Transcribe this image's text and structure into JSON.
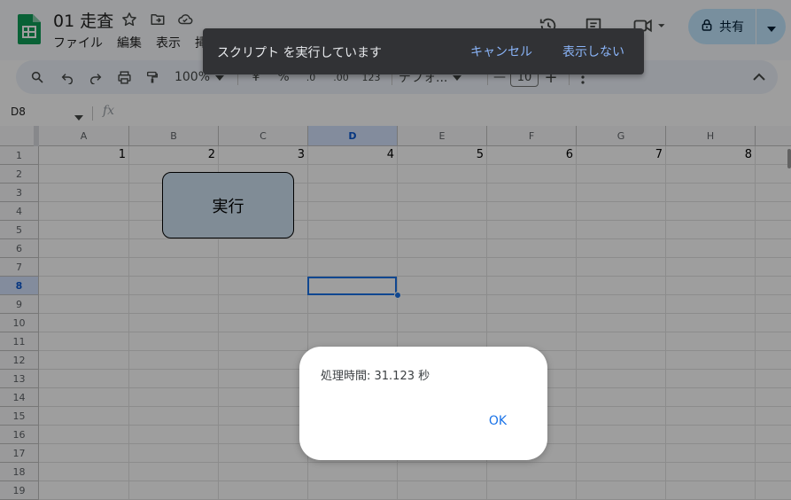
{
  "header": {
    "doc_title": "01 走査",
    "menu": [
      "ファイル",
      "編集",
      "表示",
      "挿"
    ],
    "share_label": "共有"
  },
  "toolbar": {
    "zoom": "100%",
    "currency": "¥",
    "percent": "%",
    "dec_decrease": ".0",
    "dec_increase": ".00",
    "number_format": "123",
    "font": "デフォ...",
    "font_size": "10",
    "minus": "—",
    "plus": "+"
  },
  "formula_bar": {
    "name_box": "D8",
    "fx": "fx"
  },
  "grid": {
    "columns": [
      "A",
      "B",
      "C",
      "D",
      "E",
      "F",
      "G",
      "H"
    ],
    "selected_column": "D",
    "rows": [
      "1",
      "2",
      "3",
      "4",
      "5",
      "6",
      "7",
      "8",
      "9",
      "10",
      "11",
      "12",
      "13",
      "14",
      "15",
      "16",
      "17",
      "18",
      "19"
    ],
    "selected_row": "8",
    "row1_values": [
      "1",
      "2",
      "3",
      "4",
      "5",
      "6",
      "7",
      "8"
    ],
    "drawing_label": "実行"
  },
  "snackbar": {
    "message": "スクリプト を実行しています",
    "cancel_label": "キャンセル",
    "hide_label": "表示しない"
  },
  "dialog": {
    "message": "処理時間: 31.123 秒",
    "ok_label": "OK"
  },
  "colors": {
    "accent": "#1a73e8",
    "share_bg": "#c2e7ff",
    "snackbar_bg": "#313235",
    "snackbar_link": "#8ab4f8",
    "drawing_fill": "#cfe2f3"
  }
}
